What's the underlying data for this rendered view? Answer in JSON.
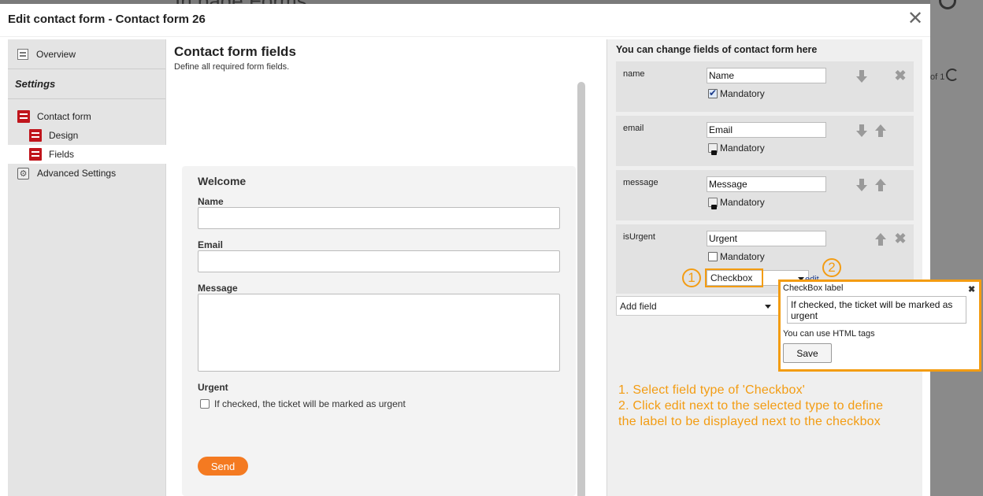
{
  "background": {
    "title": "In page Forms",
    "pager": "of 1"
  },
  "dialog": {
    "title": "Edit contact form - Contact form 26",
    "close_symbol": "✕"
  },
  "sidebar": {
    "overview": "Overview",
    "settings_heading": "Settings",
    "items": [
      {
        "label": "Contact form",
        "icon": "form-icon"
      },
      {
        "label": "Design",
        "icon": "form-icon"
      },
      {
        "label": "Fields",
        "icon": "form-icon"
      },
      {
        "label": "Advanced Settings",
        "icon": "gear-icon"
      }
    ]
  },
  "middle": {
    "title": "Contact form fields",
    "subtitle": "Define all required form fields.",
    "preview": {
      "welcome": "Welcome",
      "name_label": "Name",
      "email_label": "Email",
      "message_label": "Message",
      "urgent_label": "Urgent",
      "urgent_checkbox_text": "If checked, the ticket will be marked as urgent",
      "send_label": "Send"
    }
  },
  "right": {
    "heading": "You can change fields of contact form here",
    "fields": [
      {
        "name": "name",
        "value": "Name",
        "mandatory_label": "Mandatory"
      },
      {
        "name": "email",
        "value": "Email",
        "mandatory_label": "Mandatory"
      },
      {
        "name": "message",
        "value": "Message",
        "mandatory_label": "Mandatory"
      },
      {
        "name": "isUrgent",
        "value": "Urgent",
        "mandatory_label": "Mandatory",
        "type": "Checkbox",
        "edit_label": "edit"
      }
    ],
    "add_field": "Add field",
    "badges": [
      "1",
      "2"
    ]
  },
  "popup": {
    "title": "CheckBox label",
    "close_symbol": "✖",
    "value": "If checked, the ticket will be marked as urgent",
    "hint": "You can use HTML tags",
    "save_label": "Save"
  },
  "instructions": {
    "line1": "1. Select field type of 'Checkbox'",
    "line2": "2. Click edit next to the selected type to define the label to be displayed next to the checkbox"
  },
  "colors": {
    "accent": "#f39c12",
    "send_button": "#f47a21",
    "sidebar_icon": "#c0151c"
  }
}
